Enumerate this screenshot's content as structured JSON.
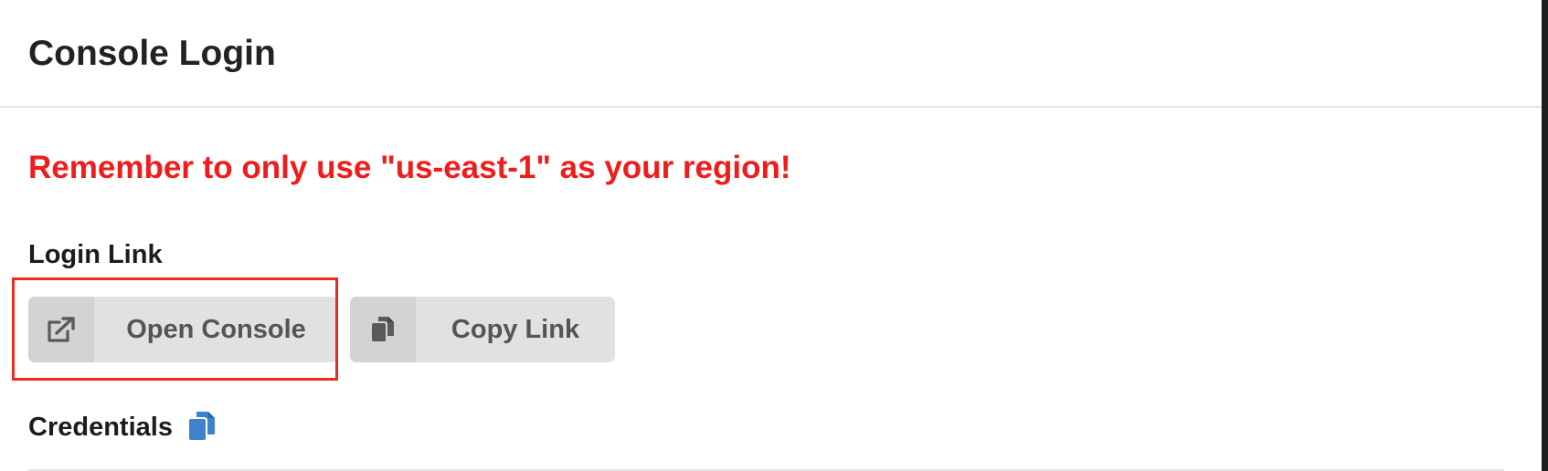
{
  "header": {
    "title": "Console Login"
  },
  "warning": {
    "text": "Remember to only use \"us-east-1\" as your region!",
    "color": "#ef1c1c"
  },
  "login_link": {
    "label": "Login Link",
    "open_button": {
      "label": "Open Console",
      "icon": "external-link-icon"
    },
    "copy_button": {
      "label": "Copy Link",
      "icon": "copy-icon"
    }
  },
  "credentials": {
    "label": "Credentials",
    "copy_icon": "copy-icon",
    "copy_icon_color": "#3e82cc"
  },
  "annotation": {
    "highlight_color": "#ee2b20"
  }
}
